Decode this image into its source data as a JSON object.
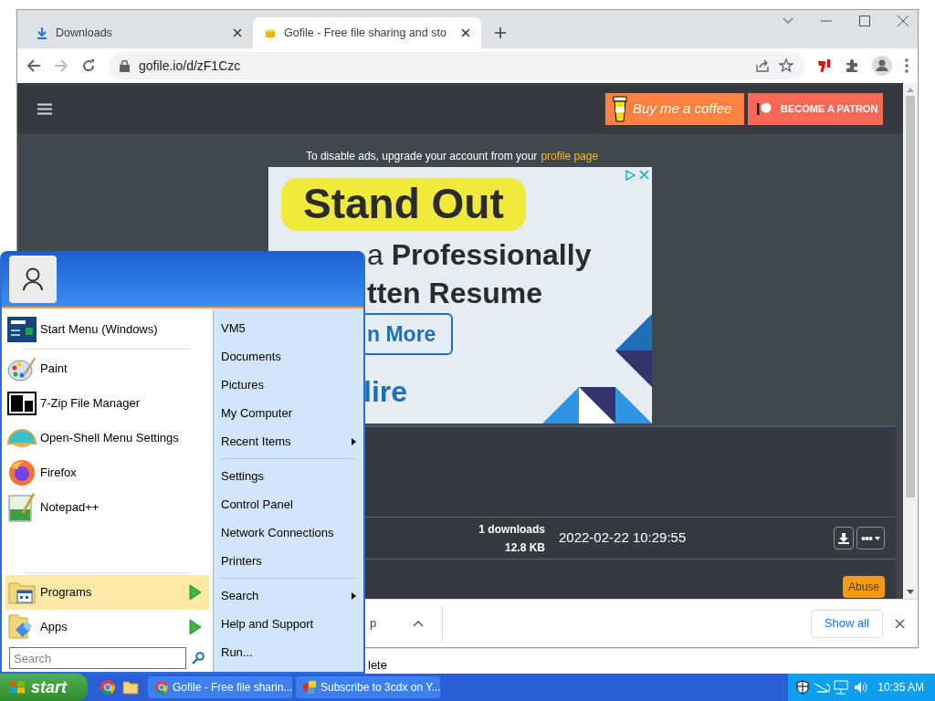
{
  "background_window": {
    "status_fragment": "lete"
  },
  "browser": {
    "tabs": [
      {
        "label": "Downloads",
        "selected": false,
        "kind": "download"
      },
      {
        "label": "Gofile - Free file sharing and sto",
        "selected": true,
        "kind": "gofile"
      }
    ],
    "url": "gofile.io/d/zF1Czc"
  },
  "page": {
    "support_buttons": [
      {
        "label": "Buy me a coffee",
        "kind": "coffee"
      },
      {
        "label": "BECOME A PATRON",
        "kind": "patreon"
      }
    ],
    "notice_text": "To disable ads, upgrade your account from your",
    "notice_link": "profile page",
    "ad": {
      "headline": "Stand Out",
      "line_2": "a **Professionally**",
      "line_3": "tten Resume",
      "button": "n More",
      "brand": "lire"
    },
    "file": {
      "downloads": "1 downloads",
      "size": "12.8 KB",
      "date": "2022-02-22 10:29:55",
      "abuse": "Abuse"
    }
  },
  "download_bar": {
    "item_fragment": "p",
    "show_all": "Show all"
  },
  "start_menu": {
    "pinned": [
      {
        "label": "Start Menu (Windows)",
        "kind": "startmenu"
      }
    ],
    "recent": [
      {
        "label": "Paint",
        "kind": "paint"
      },
      {
        "label": "7-Zip File Manager",
        "kind": "sevenzip"
      },
      {
        "label": "Open-Shell Menu Settings",
        "kind": "shell"
      },
      {
        "label": "Firefox",
        "kind": "firefox"
      },
      {
        "label": "Notepad++",
        "kind": "notepad"
      }
    ],
    "folders": [
      {
        "label": "Programs",
        "selected": true,
        "kind": "programs"
      },
      {
        "label": "Apps",
        "selected": false,
        "kind": "apps"
      }
    ],
    "search_placeholder": "Search",
    "place_groups": [
      {
        "items": [
          {
            "label": "VM5",
            "submenu": false
          },
          {
            "label": "Documents",
            "submenu": false
          },
          {
            "label": "Pictures",
            "submenu": false
          },
          {
            "label": "My Computer",
            "submenu": false
          },
          {
            "label": "Recent Items",
            "submenu": true
          }
        ]
      },
      {
        "items": [
          {
            "label": "Settings",
            "submenu": false
          },
          {
            "label": "Control Panel",
            "submenu": false
          },
          {
            "label": "Network Connections",
            "submenu": false
          },
          {
            "label": "Printers",
            "submenu": false
          }
        ]
      },
      {
        "items": [
          {
            "label": "Search",
            "submenu": true
          },
          {
            "label": "Help and Support",
            "submenu": false
          },
          {
            "label": "Run...",
            "submenu": false
          }
        ]
      }
    ]
  },
  "taskbar": {
    "start": "start",
    "tasks": [
      {
        "label": "Gofile - Free file sharin...",
        "kind": "chrome",
        "selected": false
      },
      {
        "label": "Subscribe to 3cdx on Y...",
        "kind": "app",
        "selected": false
      }
    ],
    "clock": "10:35 AM"
  }
}
